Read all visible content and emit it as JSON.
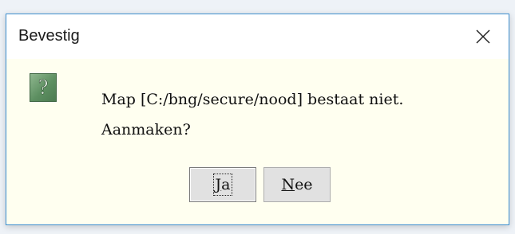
{
  "dialog": {
    "title": "Bevestig",
    "close_icon": "close-icon",
    "question_icon": "question-icon",
    "message_line1": "Map [C:/bng/secure/nood] bestaat niet.",
    "message_line2": "Aanmaken?",
    "buttons": {
      "yes": {
        "accel": "J",
        "rest": "a"
      },
      "no": {
        "accel": "N",
        "rest": "ee"
      }
    }
  }
}
